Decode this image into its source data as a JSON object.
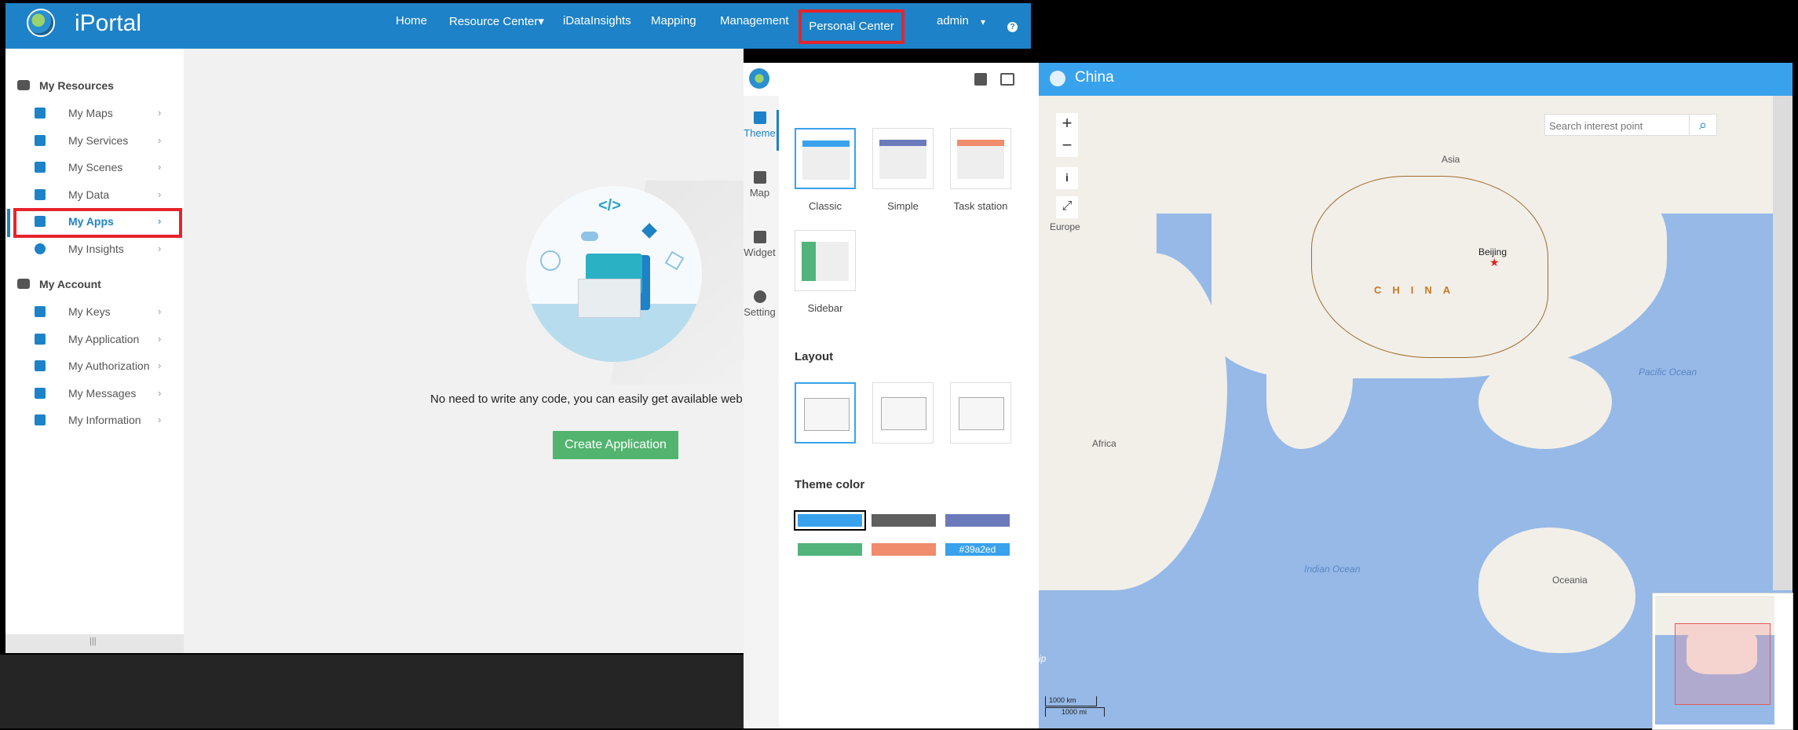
{
  "topnav": {
    "brand": "iPortal",
    "items": [
      "Home",
      "Resource Center▾",
      "iDataInsights",
      "Mapping",
      "Management"
    ],
    "active_item": "Personal Center",
    "user": "admin",
    "user_caret": "▾",
    "help_glyph": "?"
  },
  "sidebar": {
    "resources_title": "My Resources",
    "resource_items": [
      "My Maps",
      "My Services",
      "My Scenes",
      "My Data",
      "My Apps",
      "My Insights"
    ],
    "account_title": "My Account",
    "account_items": [
      "My Keys",
      "My Application",
      "My Authorization",
      "My Messages",
      "My Information"
    ],
    "chevron": "›",
    "grip": "|||"
  },
  "main": {
    "illus_code": "</>",
    "message": "No need to write any code, you can easily get available web a",
    "create_button": "Create Application"
  },
  "designer": {
    "tabs": [
      "Theme",
      "Map",
      "Widget",
      "Setting"
    ],
    "themes": [
      "Classic",
      "Simple",
      "Task station",
      "Sidebar"
    ],
    "layout_title": "Layout",
    "theme_color_title": "Theme color",
    "swatch_colors": [
      "#39a2ed",
      "#5f5f5f",
      "#6b7abb",
      "#52b47b",
      "#f08c6c",
      "#39a2ed"
    ],
    "custom_color_label": "#39a2ed"
  },
  "map": {
    "title": "China",
    "search_placeholder": "Search interest point",
    "zoom_in": "+",
    "zoom_out": "−",
    "info_glyph": "i",
    "fullscreen_glyph": "⤢",
    "labels": {
      "asia": "Asia",
      "europe": "Europe",
      "africa": "Africa",
      "oceania": "Oceania",
      "china": "CHINA",
      "beijing": "Beijing",
      "pacific": "Pacific Ocean",
      "indian": "Indian Ocean",
      "edge": "ip"
    },
    "scale": {
      "km": "1000 km",
      "mi": "1000 mi"
    }
  },
  "colors": {
    "nav": "#1d82c7",
    "accent": "#39a2ed",
    "highlight": "#e6242b",
    "create": "#52b46f"
  }
}
